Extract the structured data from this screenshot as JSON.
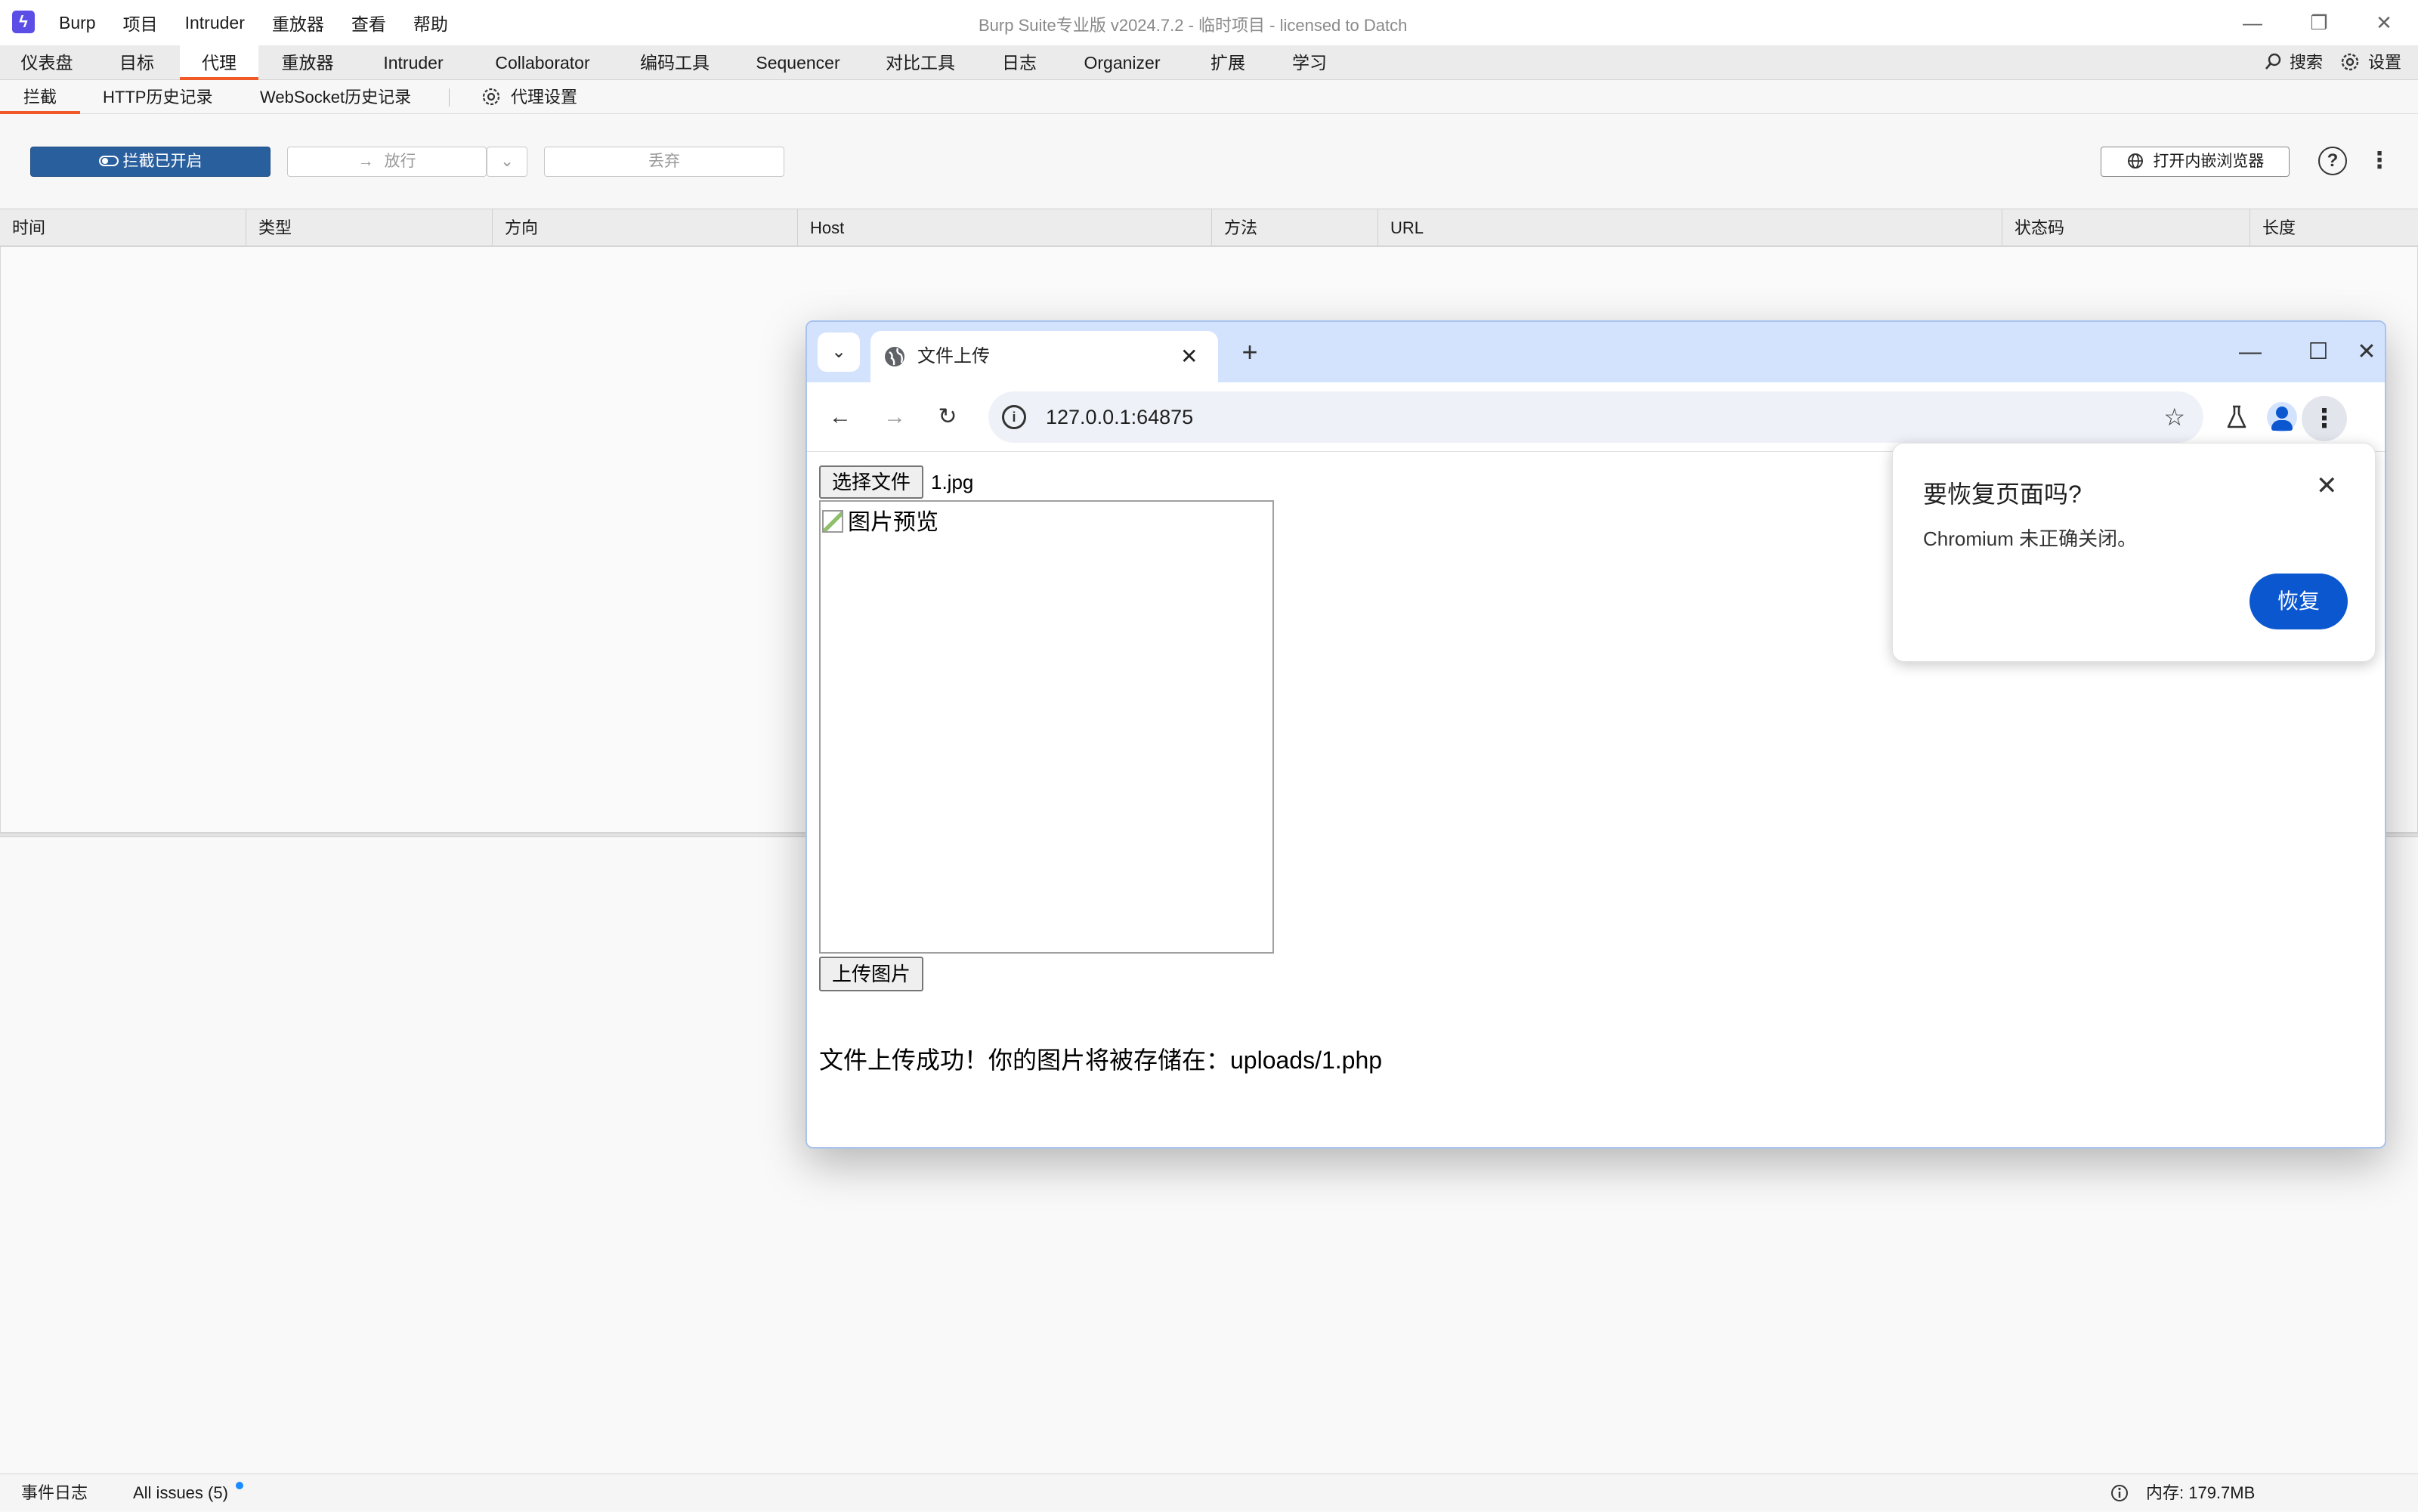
{
  "app": {
    "logo_glyph": "ϟ",
    "menu": [
      "Burp",
      "项目",
      "Intruder",
      "重放器",
      "查看",
      "帮助"
    ],
    "window_title": "Burp Suite专业版  v2024.7.2 - 临时项目 - licensed to Datch",
    "win_minimize": "—",
    "win_restore": "❐",
    "win_close": "✕"
  },
  "main_tabs": [
    "仪表盘",
    "目标",
    "代理",
    "重放器",
    "Intruder",
    "Collaborator",
    "编码工具",
    "Sequencer",
    "对比工具",
    "日志",
    "Organizer",
    "扩展",
    "学习"
  ],
  "main_tabs_right": {
    "search": "搜索",
    "settings": "设置"
  },
  "sub_tabs": {
    "intercept": "拦截",
    "http_history": "HTTP历史记录",
    "ws_history": "WebSocket历史记录",
    "proxy_settings": "代理设置"
  },
  "toolbar": {
    "intercept_on": "拦截已开启",
    "forward": "放行",
    "drop": "丢弃",
    "open_browser": "打开内嵌浏览器"
  },
  "table": {
    "columns": [
      "时间",
      "类型",
      "方向",
      "Host",
      "方法",
      "URL",
      "状态码",
      "长度"
    ]
  },
  "statusbar": {
    "event_log": "事件日志",
    "issues": "All issues (5)",
    "memory": "内存: 179.7MB"
  },
  "browser": {
    "tab_title": "文件上传",
    "url": "127.0.0.1:64875",
    "page": {
      "choose_file": "选择文件",
      "file_name": "1.jpg",
      "preview_alt": "图片预览",
      "upload_button": "上传图片",
      "message": "文件上传成功！你的图片将被存储在：uploads/1.php"
    },
    "popup": {
      "title": "要恢复页面吗?",
      "body": "Chromium 未正确关闭。",
      "restore": "恢复"
    }
  },
  "colors": {
    "accent_orange": "#f05a28",
    "intercept_blue": "#2a5f9e",
    "chrome_blue": "#0b57d0"
  }
}
